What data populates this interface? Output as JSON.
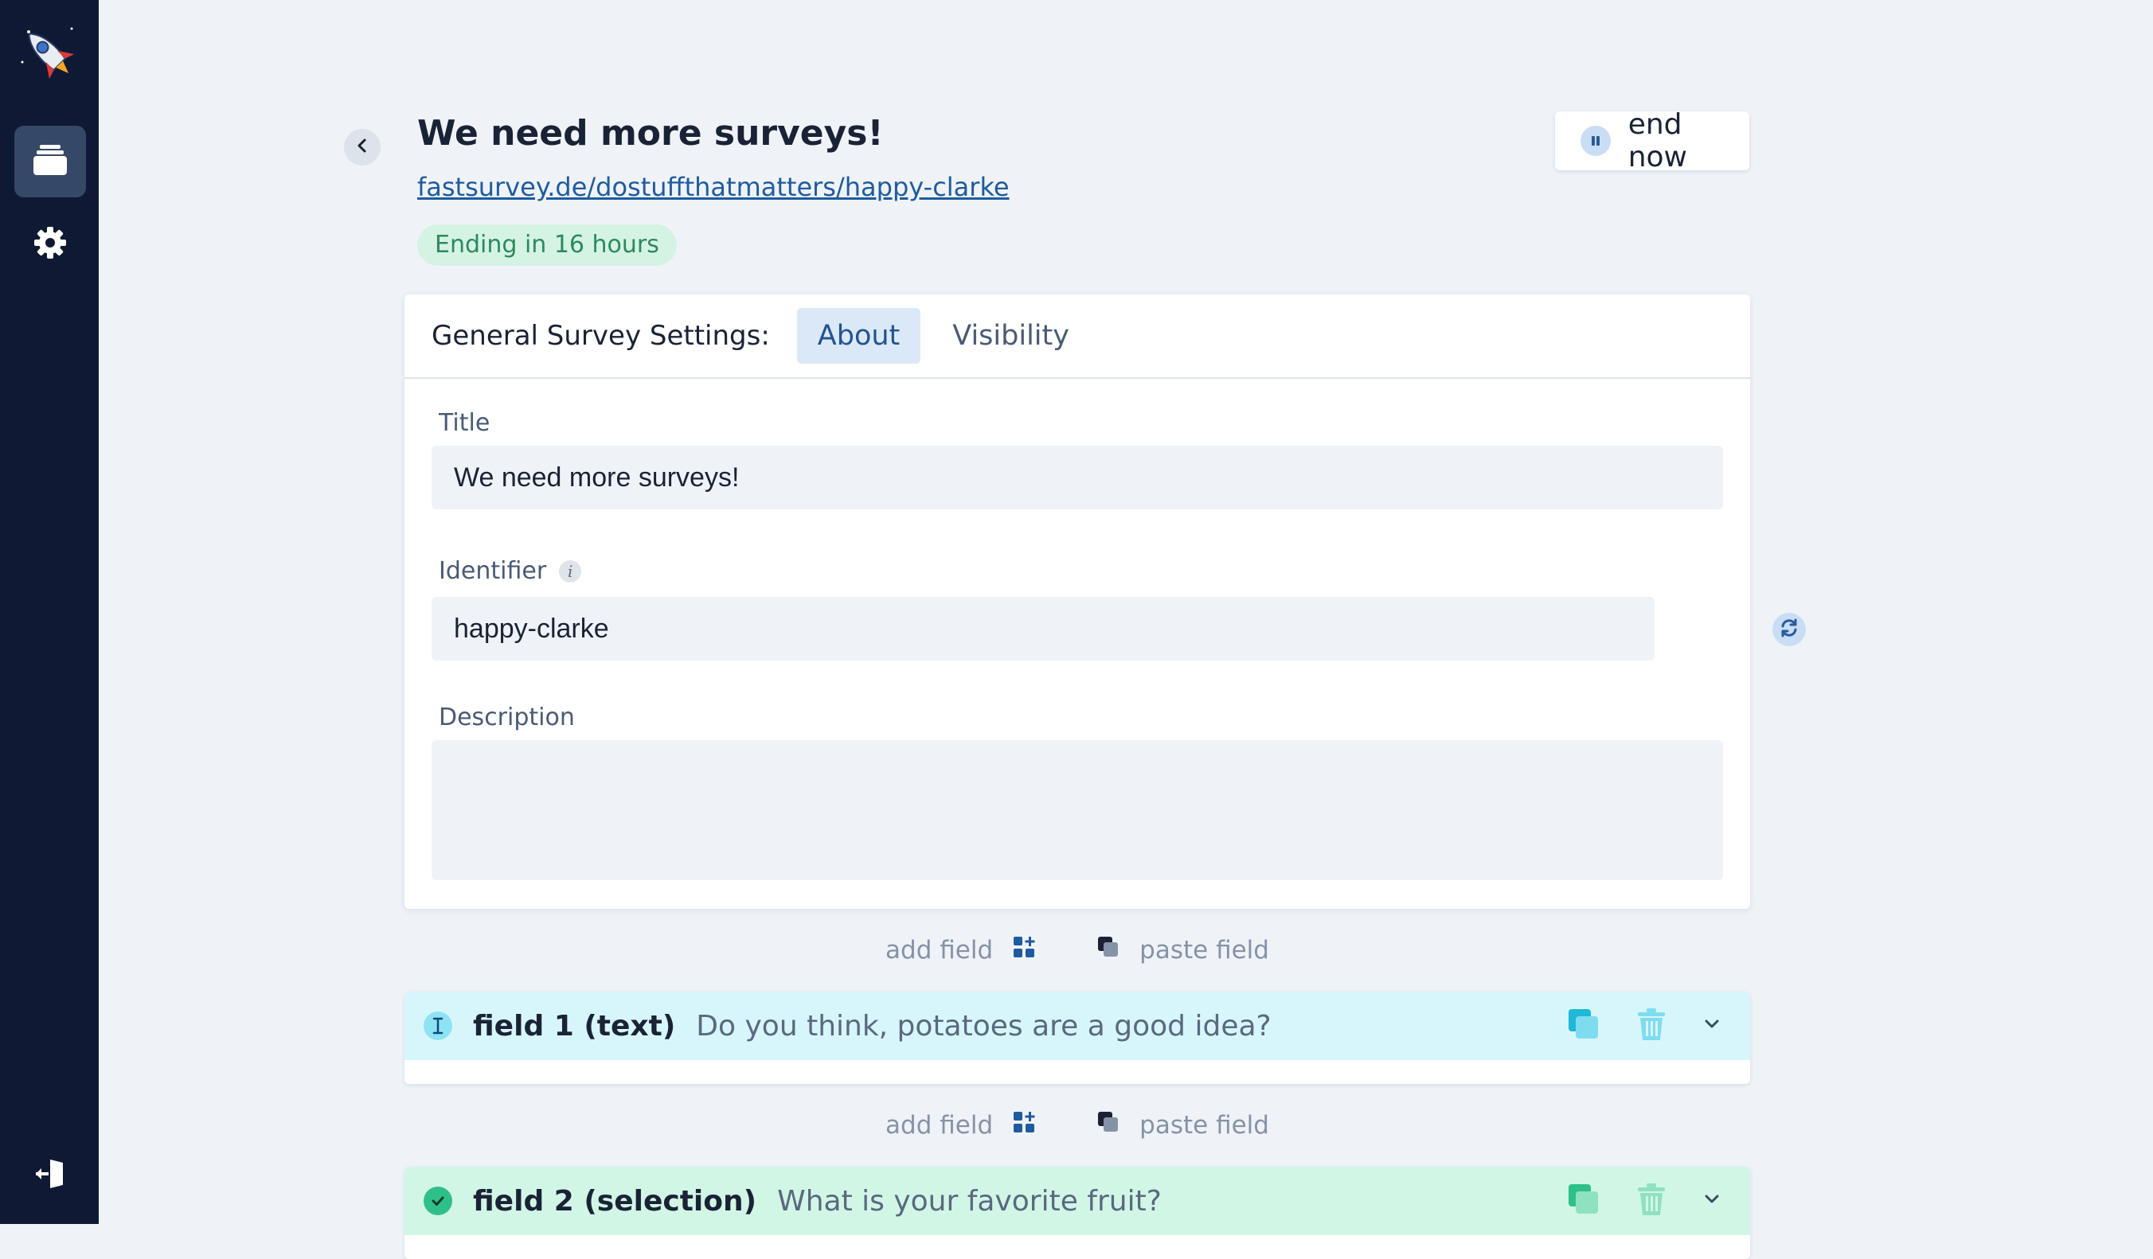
{
  "sidebar": {
    "logo_icon": "rocket-logo-icon",
    "items": [
      {
        "icon": "surveys-stack-icon",
        "active": true
      },
      {
        "icon": "gear-icon",
        "active": false
      }
    ],
    "logout_icon": "logout-icon"
  },
  "header": {
    "title": "We need more surveys!",
    "link": "fastsurvey.de/dostuffthatmatters/happy-clarke",
    "status": "Ending in 16 hours",
    "end_button_label": "end now"
  },
  "settings": {
    "label": "General Survey Settings:",
    "tabs": [
      {
        "label": "About",
        "active": true
      },
      {
        "label": "Visibility",
        "active": false
      }
    ],
    "title_label": "Title",
    "title_value": "We need more surveys!",
    "identifier_label": "Identifier",
    "identifier_value": "happy-clarke",
    "description_label": "Description",
    "description_value": ""
  },
  "actions": {
    "add_field": "add field",
    "paste_field": "paste field"
  },
  "fields": [
    {
      "name": "field 1 (text)",
      "question": "Do you think, potatoes are a good idea?",
      "type": "text",
      "accent": "#1fb8d6"
    },
    {
      "name": "field 2 (selection)",
      "question": "What is your favorite fruit?",
      "type": "selection",
      "accent": "#2fc08a"
    }
  ],
  "colors": {
    "sidebar_bg": "#0f1933",
    "page_bg": "#eff3f8",
    "link": "#1f5b9f",
    "badge_bg": "#d5f3e3",
    "badge_text": "#2c8a5c"
  }
}
